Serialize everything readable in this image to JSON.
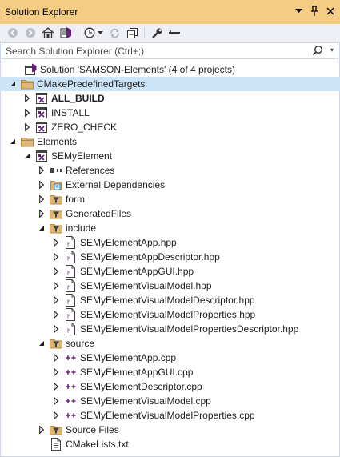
{
  "window": {
    "title": "Solution Explorer"
  },
  "search": {
    "placeholder": "Search Solution Explorer (Ctrl+;)"
  },
  "tree": [
    {
      "label": "Solution 'SAMSON-Elements' (4 of 4 projects)",
      "icon": "solution-icon",
      "arrow": "none",
      "depth": 0
    },
    {
      "label": "CMakePredefinedTargets",
      "icon": "folder-icon",
      "arrow": "expanded",
      "depth": 1,
      "selected": true
    },
    {
      "label": "ALL_BUILD",
      "icon": "project-icon",
      "arrow": "collapsed",
      "depth": 2,
      "bold": true
    },
    {
      "label": "INSTALL",
      "icon": "project-icon",
      "arrow": "collapsed",
      "depth": 2
    },
    {
      "label": "ZERO_CHECK",
      "icon": "project-icon",
      "arrow": "collapsed",
      "depth": 2
    },
    {
      "label": "Elements",
      "icon": "folder-icon",
      "arrow": "expanded",
      "depth": 1
    },
    {
      "label": "SEMyElement",
      "icon": "project-icon",
      "arrow": "expanded",
      "depth": 2
    },
    {
      "label": "References",
      "icon": "references-icon",
      "arrow": "collapsed",
      "depth": 3
    },
    {
      "label": "External Dependencies",
      "icon": "dependencies-icon",
      "arrow": "collapsed",
      "depth": 3
    },
    {
      "label": "form",
      "icon": "filter-icon",
      "arrow": "collapsed",
      "depth": 3
    },
    {
      "label": "GeneratedFiles",
      "icon": "filter-icon",
      "arrow": "collapsed",
      "depth": 3
    },
    {
      "label": "include",
      "icon": "filter-icon",
      "arrow": "expanded",
      "depth": 3
    },
    {
      "label": "SEMyElementApp.hpp",
      "icon": "header-file-icon",
      "arrow": "collapsed",
      "depth": 4
    },
    {
      "label": "SEMyElementAppDescriptor.hpp",
      "icon": "header-file-icon",
      "arrow": "collapsed",
      "depth": 4
    },
    {
      "label": "SEMyElementAppGUI.hpp",
      "icon": "header-file-icon",
      "arrow": "collapsed",
      "depth": 4
    },
    {
      "label": "SEMyElementVisualModel.hpp",
      "icon": "header-file-icon",
      "arrow": "collapsed",
      "depth": 4
    },
    {
      "label": "SEMyElementVisualModelDescriptor.hpp",
      "icon": "header-file-icon",
      "arrow": "collapsed",
      "depth": 4
    },
    {
      "label": "SEMyElementVisualModelProperties.hpp",
      "icon": "header-file-icon",
      "arrow": "collapsed",
      "depth": 4
    },
    {
      "label": "SEMyElementVisualModelPropertiesDescriptor.hpp",
      "icon": "header-file-icon",
      "arrow": "collapsed",
      "depth": 4
    },
    {
      "label": "source",
      "icon": "filter-icon",
      "arrow": "expanded",
      "depth": 3
    },
    {
      "label": "SEMyElementApp.cpp",
      "icon": "cpp-file-icon",
      "arrow": "collapsed",
      "depth": 4
    },
    {
      "label": "SEMyElementAppGUI.cpp",
      "icon": "cpp-file-icon",
      "arrow": "collapsed",
      "depth": 4
    },
    {
      "label": "SEMyElementDescriptor.cpp",
      "icon": "cpp-file-icon",
      "arrow": "collapsed",
      "depth": 4
    },
    {
      "label": "SEMyElementVisualModel.cpp",
      "icon": "cpp-file-icon",
      "arrow": "collapsed",
      "depth": 4
    },
    {
      "label": "SEMyElementVisualModelProperties.cpp",
      "icon": "cpp-file-icon",
      "arrow": "collapsed",
      "depth": 4
    },
    {
      "label": "Source Files",
      "icon": "filter-icon",
      "arrow": "collapsed",
      "depth": 3
    },
    {
      "label": "CMakeLists.txt",
      "icon": "text-file-icon",
      "arrow": "none",
      "depth": 3
    }
  ],
  "colors": {
    "titlebar": "#f5cc84",
    "selection": "#cce4f7",
    "toolbar": "#eef0f5"
  }
}
